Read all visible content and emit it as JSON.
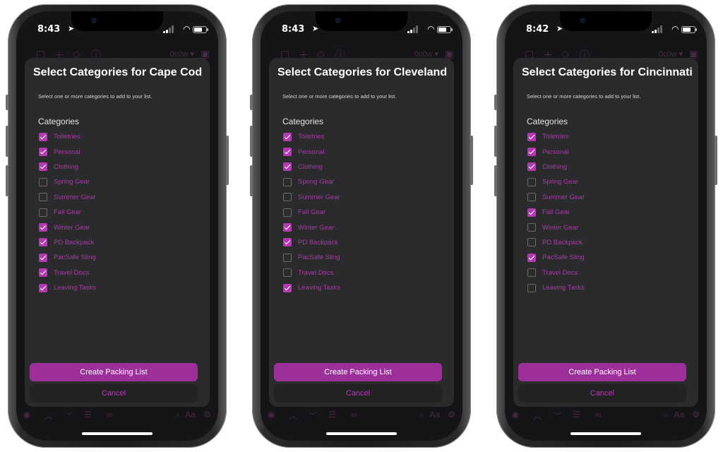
{
  "subtitle": "Select one or more categories to add to your list.",
  "categories_heading": "Categories",
  "create_label": "Create Packing List",
  "cancel_label": "Cancel",
  "toolbar": {
    "dropdown": "0c0w ▾"
  },
  "bottom_aa": "Aa",
  "accent_color": "#b23bb0",
  "button_color": "#9d2f9b",
  "phones": [
    {
      "time": "8:43",
      "title": "Select Categories for Cape Cod",
      "items": [
        {
          "label": "Toiletries",
          "checked": true
        },
        {
          "label": "Personal",
          "checked": true
        },
        {
          "label": "Clothing",
          "checked": true
        },
        {
          "label": "Spring Gear",
          "checked": false
        },
        {
          "label": "Summer Gear",
          "checked": false
        },
        {
          "label": "Fall Gear",
          "checked": false
        },
        {
          "label": "Winter Gear",
          "checked": true
        },
        {
          "label": "PD Backpack",
          "checked": true
        },
        {
          "label": "PacSafe Sling",
          "checked": true
        },
        {
          "label": "Travel Docs",
          "checked": true
        },
        {
          "label": "Leaving Tasks",
          "checked": true
        }
      ]
    },
    {
      "time": "8:43",
      "title": "Select Categories for Cleveland",
      "items": [
        {
          "label": "Toiletries",
          "checked": true
        },
        {
          "label": "Personal",
          "checked": true
        },
        {
          "label": "Clothing",
          "checked": true
        },
        {
          "label": "Spring Gear",
          "checked": false
        },
        {
          "label": "Summer Gear",
          "checked": false
        },
        {
          "label": "Fall Gear",
          "checked": false
        },
        {
          "label": "Winter Gear",
          "checked": true
        },
        {
          "label": "PD Backpack",
          "checked": true
        },
        {
          "label": "PacSafe Sling",
          "checked": false
        },
        {
          "label": "Travel Docs",
          "checked": false
        },
        {
          "label": "Leaving Tasks",
          "checked": true
        }
      ]
    },
    {
      "time": "8:42",
      "title": "Select Categories for Cincinnati",
      "items": [
        {
          "label": "Toiletries",
          "checked": true
        },
        {
          "label": "Personal",
          "checked": true
        },
        {
          "label": "Clothing",
          "checked": true
        },
        {
          "label": "Spring Gear",
          "checked": false
        },
        {
          "label": "Summer Gear",
          "checked": false
        },
        {
          "label": "Fall Gear",
          "checked": true
        },
        {
          "label": "Winter Gear",
          "checked": false
        },
        {
          "label": "PD Backpack",
          "checked": false
        },
        {
          "label": "PacSafe Sling",
          "checked": true
        },
        {
          "label": "Travel Docs",
          "checked": false
        },
        {
          "label": "Leaving Tasks",
          "checked": false
        }
      ]
    }
  ]
}
